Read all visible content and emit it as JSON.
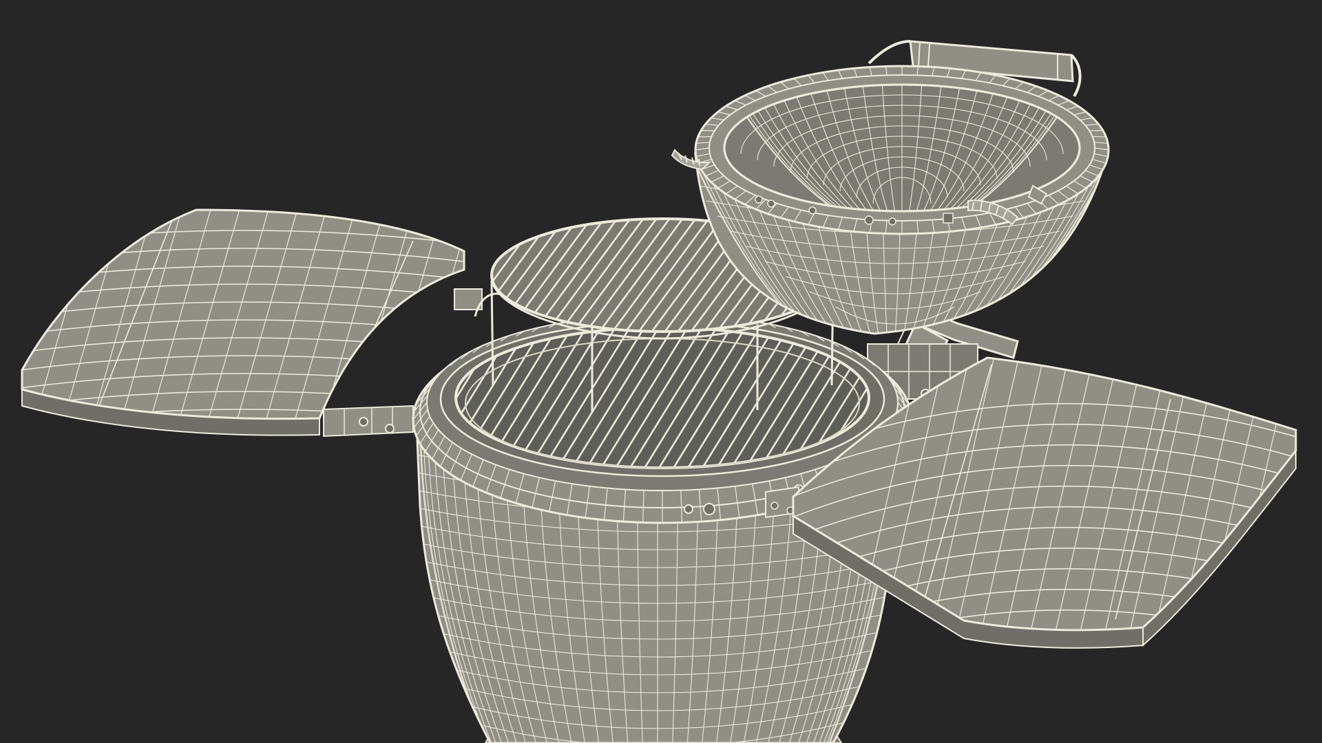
{
  "scene": {
    "subject": "kamado-grill-wireframe",
    "colors": {
      "background": "#262626",
      "surface": "#8f8f86",
      "surface_light": "#a3a399",
      "surface_dark": "#6f6f68",
      "wire": "#ecebdc",
      "wire_soft": "#d8d7c6",
      "inner": "#7b7b73"
    }
  }
}
